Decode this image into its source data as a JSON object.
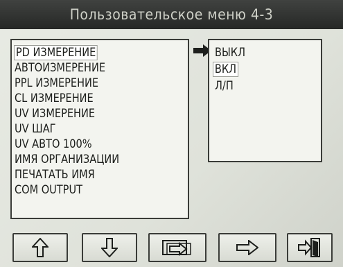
{
  "title": "Пользовательское меню 4-3",
  "menu_items": [
    {
      "label": "PD ИЗМЕРЕНИЕ",
      "selected": true
    },
    {
      "label": "АВТОИЗМЕРЕНИЕ"
    },
    {
      "label": "PPL ИЗМЕРЕНИЕ"
    },
    {
      "label": "CL ИЗМЕРЕНИЕ"
    },
    {
      "label": "UV ИЗМЕРЕНИЕ"
    },
    {
      "label": "UV ШАГ"
    },
    {
      "label": "UV АВТО 100%"
    },
    {
      "label": "ИМЯ ОРГАНИЗАЦИИ"
    },
    {
      "label": "ПЕЧАТАТЬ ИМЯ"
    },
    {
      "label": "COM OUTPUT"
    }
  ],
  "options": [
    {
      "label": "ВЫКЛ"
    },
    {
      "label": "ВКЛ",
      "selected": true
    },
    {
      "label": "Л/П"
    }
  ],
  "toolbar": [
    {
      "icon": "arrow-up-icon"
    },
    {
      "icon": "arrow-down-icon"
    },
    {
      "icon": "switch-panel-icon"
    },
    {
      "icon": "arrow-right-icon"
    },
    {
      "icon": "exit-door-icon"
    }
  ]
}
